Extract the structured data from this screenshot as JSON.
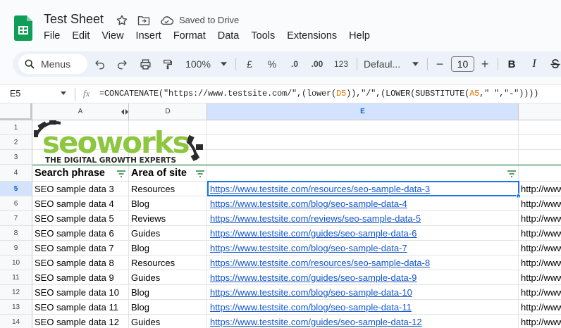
{
  "app": {
    "title": "Test Sheet",
    "save_status": "Saved to Drive",
    "menu": [
      "File",
      "Edit",
      "View",
      "Insert",
      "Format",
      "Data",
      "Tools",
      "Extensions",
      "Help"
    ]
  },
  "toolbar": {
    "menus_label": "Menus",
    "zoom": "100%",
    "currency": "£",
    "percent": "%",
    "decrease_decimal": ".0",
    "increase_decimal": ".00",
    "number_format": "123",
    "font": "Defaul...",
    "font_size": "10",
    "minus": "−",
    "plus": "+",
    "bold": "B",
    "italic": "I"
  },
  "formula_bar": {
    "name_box": "E5",
    "fx": "fx",
    "formula_parts": [
      {
        "t": "=CONCATENATE(\"https://www.testsite.com/\",(lower(",
        "ref": false
      },
      {
        "t": "D5",
        "ref": true
      },
      {
        "t": ")),\"/\",(LOWER(SUBSTITUTE(",
        "ref": false
      },
      {
        "t": "A5",
        "ref": true
      },
      {
        "t": ",\" \",\"-\"))))",
        "ref": false
      }
    ]
  },
  "logo": {
    "word": "seoworks",
    "tagline": "THE DIGITAL GROWTH EXPERTS"
  },
  "columns": [
    "A",
    "D",
    "E"
  ],
  "headers": {
    "col_a": "Search phrase",
    "col_d": "Area of site",
    "col_e": ""
  },
  "row_numbers": [
    "1",
    "2",
    "3",
    "4",
    "5",
    "6",
    "7",
    "8",
    "9",
    "10",
    "11",
    "12",
    "13",
    "14"
  ],
  "rows": [
    {
      "a": "SEO sample data 3",
      "d": "Resources",
      "e": "https://www.testsite.com/resources/seo-sample-data-3",
      "f": "http://www"
    },
    {
      "a": "SEO sample data 4",
      "d": "Blog",
      "e": "https://www.testsite.com/blog/seo-sample-data-4",
      "f": "http://www"
    },
    {
      "a": "SEO sample data 5",
      "d": "Reviews",
      "e": "https://www.testsite.com/reviews/seo-sample-data-5",
      "f": "http://www"
    },
    {
      "a": "SEO sample data 6",
      "d": "Guides",
      "e": "https://www.testsite.com/guides/seo-sample-data-6",
      "f": "http://www"
    },
    {
      "a": "SEO sample data 7",
      "d": "Blog",
      "e": "https://www.testsite.com/blog/seo-sample-data-7",
      "f": "http://www"
    },
    {
      "a": "SEO sample data 8",
      "d": "Resources",
      "e": "https://www.testsite.com/resources/seo-sample-data-8",
      "f": "http://www"
    },
    {
      "a": "SEO sample data 9",
      "d": "Guides",
      "e": "https://www.testsite.com/guides/seo-sample-data-9",
      "f": "http://www"
    },
    {
      "a": "SEO sample data 10",
      "d": "Blog",
      "e": "https://www.testsite.com/blog/seo-sample-data-10",
      "f": "http://www"
    },
    {
      "a": "SEO sample data 11",
      "d": "Blog",
      "e": "https://www.testsite.com/blog/seo-sample-data-11",
      "f": "http://www"
    },
    {
      "a": "SEO sample data 12",
      "d": "Guides",
      "e": "https://www.testsite.com/guides/seo-sample-data-12",
      "f": "http://www"
    }
  ],
  "colors": {
    "accent": "#1a73e8",
    "link": "#1155cc",
    "sheets_green": "#0f9d58",
    "logo_green": "#8dc63f"
  }
}
